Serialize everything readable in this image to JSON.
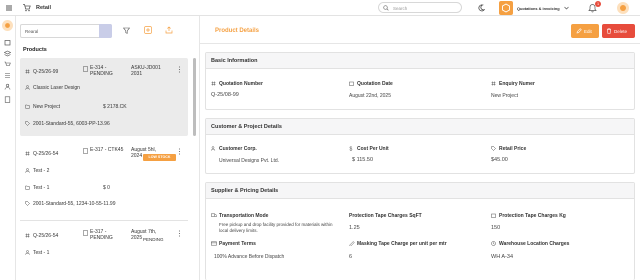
{
  "topbar": {
    "app_title": "Retail",
    "search_placeholder": "Search",
    "org_name": "Quotations & invoicing",
    "notif_count": "1"
  },
  "sidebar_icons": [
    "home-icon",
    "box-icon",
    "layers-icon",
    "cart-icon",
    "list-icon",
    "users-icon",
    "file-icon"
  ],
  "list": {
    "search_value": "Rearal",
    "heading": "Products",
    "cards": [
      {
        "qno": "Q-25/26-99",
        "code": "E-314 - PENDING",
        "asku": "ASKU-JD001 2031",
        "name": "Classic Laser Design",
        "project": "New Project",
        "amount": "$ 2178.CK",
        "spec": "2001-Standard-55, 6003-PP-13.96"
      },
      {
        "qno": "Q-25/26-54",
        "code": "E-317 - CTK45",
        "date": "August 5hl, 2024",
        "badge": "LOW STOCK",
        "name": "Test - 2",
        "project": "Test - 1",
        "amount": "$ 0",
        "spec": "2001-Standard-55, 1234-10-55-11.99"
      },
      {
        "qno": "Q-25/26-54",
        "code": "E-317 - PENDING",
        "date": "August 7th, 2025",
        "status": "PENDING",
        "name": "Test - 1"
      }
    ]
  },
  "detail": {
    "title": "Product Details",
    "edit_label": "Edit",
    "delete_label": "Delete",
    "basic": {
      "heading": "Basic Information",
      "quotation_number_label": "Quotation Number",
      "quotation_number": "Q-25/08-99",
      "quotation_date_label": "Quotation Date",
      "quotation_date": "August 22nd, 2025",
      "enquiry_number_label": "Enquiry Numer",
      "enquiry_number": "New Project"
    },
    "customer": {
      "heading": "Customer & Project Details",
      "corp_label": "Customer Corp.",
      "corp": "Universal Designs Pvt. Ltd.",
      "cost_label": "Cost Per Unit",
      "cost": "$ 115.50",
      "retail_label": "Retail Price",
      "retail": "$45.00"
    },
    "supplier": {
      "heading": "Supplier & Pricing Details",
      "transport_label": "Transportation Mode",
      "transport": "Free pickup and drop facility provided for materials within local delivery limits.",
      "tape_sqft_label": "Protection Tape Charges SqFT",
      "tape_sqft": "1.25",
      "tape_kg_label": "Protection Tape Charges Kg",
      "tape_kg": "150",
      "payment_label": "Payment Terms",
      "payment": "100% Advance Before Dispatch",
      "masking_label": "Masking Tape Charge per unit per mtr",
      "masking": "6",
      "warehouse_label": "Warehouse Location Charges",
      "warehouse": "WH A-34"
    }
  },
  "colors": {
    "accent": "#f5a042",
    "delete": "#e74c3c",
    "badge": "#f5a042"
  }
}
